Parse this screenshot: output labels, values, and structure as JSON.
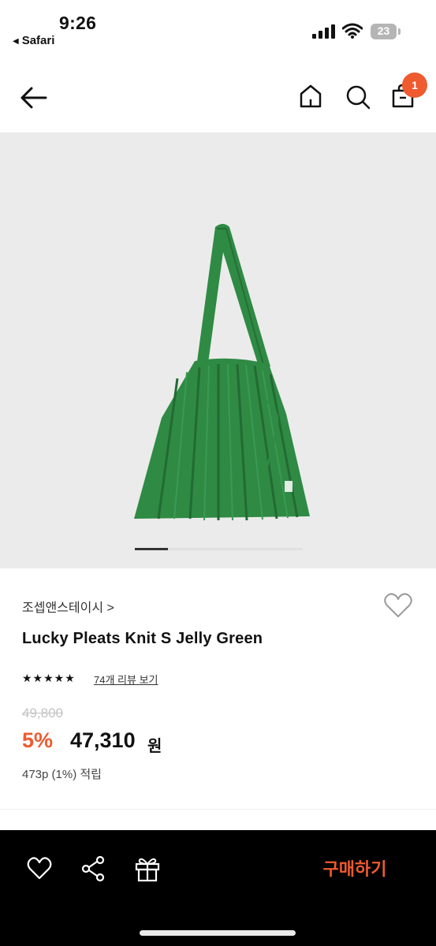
{
  "status_bar": {
    "time": "9:26",
    "back_app": "Safari",
    "battery": "23"
  },
  "nav": {
    "icons": [
      "back-arrow-icon",
      "home-icon",
      "search-icon",
      "shopping-bag-icon"
    ],
    "cart_count": "1"
  },
  "product_image": {
    "subject": "green pleated knit tote bag",
    "bag_color": "#2f8a44",
    "carousel_position": 1
  },
  "product": {
    "brand": "조셉앤스테이시 >",
    "name": "Lucky Pleats Knit S Jelly Green",
    "rating_stars": "★★★★★",
    "rating_value": 5,
    "reviews_link": "74개 리뷰 보기",
    "original_price": "49,800",
    "discount": "5%",
    "sale_price": "47,310",
    "currency": "원",
    "points": "473p (1%) 적립"
  },
  "bottom_bar": {
    "icons": [
      "heart-icon",
      "share-icon",
      "gift-icon"
    ],
    "buy_label": "구매하기",
    "accent": "#ef5a2e"
  }
}
